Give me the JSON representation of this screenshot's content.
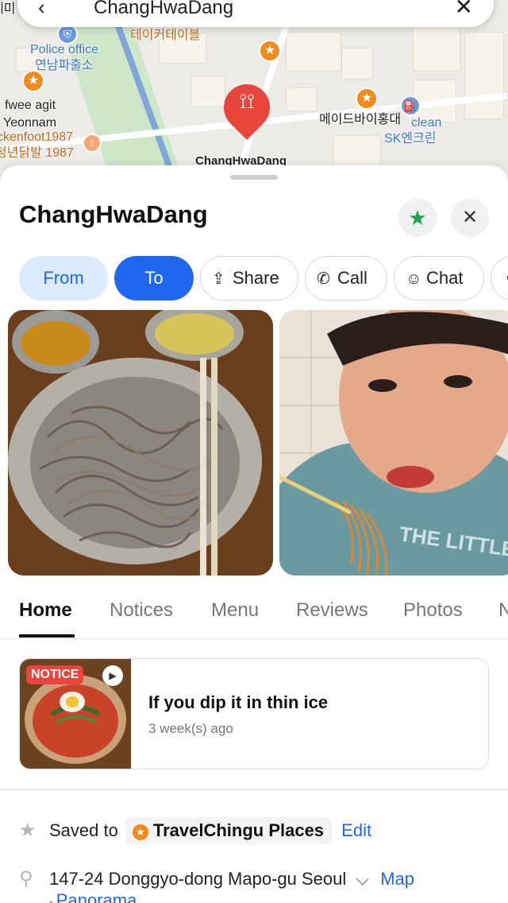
{
  "search": {
    "query": "ChangHwaDang"
  },
  "map": {
    "labels": {
      "police_en": "Police office",
      "police_ko": "연남파출소",
      "takecare": "테이커테이블",
      "fwee1": "fwee agit",
      "fwee2": "Yeonnam",
      "chicken1": "ckenfoot1987",
      "chicken2": "청년닭발 1987",
      "made_by": "메이드바이홍대",
      "clean": "clean",
      "sk": "SK엔크린",
      "edge_left": "네미",
      "main_pin": "ChangHwaDang"
    }
  },
  "place": {
    "name": "ChangHwaDang"
  },
  "actions": {
    "from": "From",
    "to": "To",
    "share": "Share",
    "call": "Call",
    "chat": "Chat"
  },
  "tabs": [
    "Home",
    "Notices",
    "Menu",
    "Reviews",
    "Photos",
    "N"
  ],
  "notice": {
    "tag": "NOTICE",
    "title": "If you dip it in thin ice",
    "time": "3 week(s) ago"
  },
  "info": {
    "saved_label": "Saved to",
    "saved_list": "TravelChingu Places",
    "edit": "Edit",
    "address": "147-24 Donggyo-dong Mapo-gu Seoul",
    "map_link": "Map",
    "panorama": "Panorama"
  },
  "colors": {
    "primary_blue": "#1f67f0",
    "light_blue": "#dceaff",
    "pin_red": "#e8453c",
    "poi_orange": "#f08a1c",
    "saved_star_green": "#1fa34a"
  }
}
